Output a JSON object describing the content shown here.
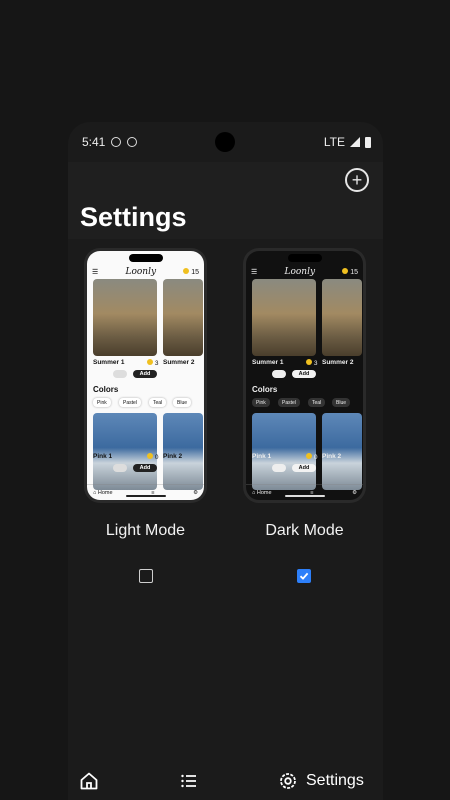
{
  "status": {
    "time": "5:41",
    "network": "LTE"
  },
  "header": {
    "title": "Settings",
    "add_icon": "plus-circle-icon"
  },
  "options": [
    {
      "label": "Light Mode",
      "checked": false
    },
    {
      "label": "Dark Mode",
      "checked": true
    }
  ],
  "preview": {
    "logo": "Loonly",
    "coins": "15",
    "tiles_top": [
      "Summer 1",
      "Summer 2"
    ],
    "tiles_bottom": [
      "Pink 1",
      "Pink 2"
    ],
    "badge_top": "3",
    "badge_bottom": "0",
    "add_label": "Add",
    "colors_heading": "Colors",
    "chips": [
      "Pink",
      "Pastel",
      "Teal",
      "Blue"
    ],
    "nav_home": "Home"
  },
  "tabbar": {
    "settings_label": "Settings"
  },
  "colors": {
    "accent": "#2d7ff9",
    "background": "#161616",
    "surface": "#1b1b1b"
  }
}
